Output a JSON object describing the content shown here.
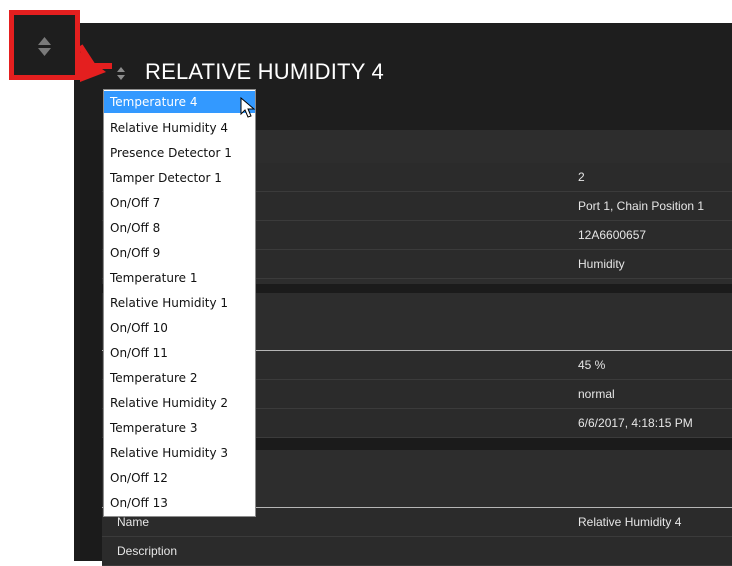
{
  "header": {
    "title": "RELATIVE HUMIDITY 4"
  },
  "dropdown": {
    "items": [
      "Temperature 4",
      "Relative Humidity 4",
      "Presence Detector 1",
      "Tamper Detector 1",
      "On/Off 7",
      "On/Off 8",
      "On/Off 9",
      "Temperature 1",
      "Relative Humidity 1",
      "On/Off 10",
      "On/Off 11",
      "Temperature 2",
      "Relative Humidity 2",
      "Temperature 3",
      "Relative Humidity 3",
      "On/Off 12",
      "On/Off 13"
    ],
    "selected": "Temperature 4"
  },
  "device": {
    "values": [
      "2",
      "Port 1, Chain Position 1",
      "12A6600657",
      "Humidity"
    ]
  },
  "measurement": {
    "values": [
      "45 %",
      "normal",
      "6/6/2017, 4:18:15 PM"
    ]
  },
  "settings": {
    "name_label": "Name",
    "name_value": "Relative Humidity 4",
    "description_label": "Description"
  },
  "colors": {
    "highlight_border": "#e41f1f",
    "selection": "#3399ff",
    "background": "#1b1b1b"
  },
  "icons": {
    "sort": "sort-arrows-icon",
    "cursor": "mouse-pointer-icon"
  }
}
